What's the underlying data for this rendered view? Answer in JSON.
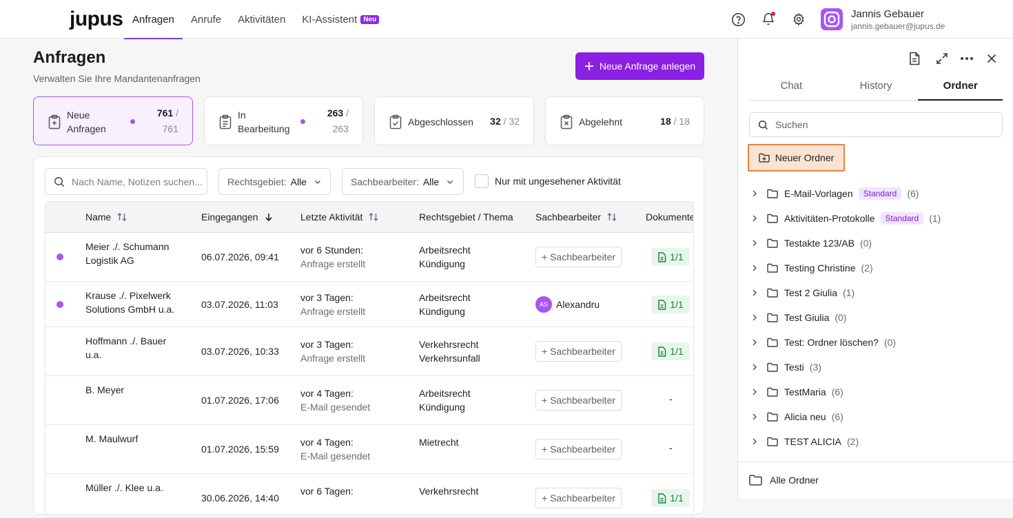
{
  "app": {
    "logo": "jupus",
    "nav": [
      {
        "label": "Anfragen"
      },
      {
        "label": "Anrufe"
      },
      {
        "label": "Aktivitäten"
      },
      {
        "label": "KI-Assistent",
        "badge": "Neu"
      }
    ],
    "icons": [
      "help-icon",
      "bell-icon",
      "gear-icon"
    ],
    "user": {
      "name": "Jannis Gebauer",
      "email": "jannis.gebauer@jupus.de"
    },
    "accent": "#8b1fe3"
  },
  "page": {
    "title": "Anfragen",
    "subtitle": "Verwalten Sie Ihre Mandantenanfragen",
    "new_button": "Neue Anfrage anlegen"
  },
  "stats": [
    {
      "line1": "Neue",
      "line2": "Anfragen",
      "count": "761",
      "total": "/",
      "total2": "761"
    },
    {
      "line1": "In",
      "line2": "Bearbeitung",
      "count": "263",
      "total": "/",
      "total2": "263"
    },
    {
      "label": "Abgeschlossen",
      "count": "32",
      "total": "/ 32"
    },
    {
      "label": "Abgelehnt",
      "count": "18",
      "total": "/ 18"
    }
  ],
  "filters": {
    "search_placeholder": "Nach Name, Notizen suchen...",
    "rechtsgebiet_label": "Rechtsgebiet:",
    "rechtsgebiet_value": "Alle",
    "sachbearbeiter_label": "Sachbearbeiter:",
    "sachbearbeiter_value": "Alle",
    "unseen_label": "Nur mit ungesehener Aktivität"
  },
  "table": {
    "headers": {
      "name": "Name",
      "received": "Eingegangen",
      "last_activity": "Letzte Aktivität",
      "area": "Rechtsgebiet / Thema",
      "assignee": "Sachbearbeiter",
      "documents": "Dokumente"
    },
    "assign_label": "+ Sachbearbeiter",
    "rows": [
      {
        "name1": "Meier ./. Schumann",
        "name2": "Logistik AG",
        "received": "06.07.2026, 09:41",
        "act1": "vor 6 Stunden:",
        "act2": "Anfrage erstellt",
        "area1": "Arbeitsrecht",
        "area2": "Kündigung",
        "docs": "1/1"
      },
      {
        "name1": "Krause ./. Pixelwerk",
        "name2": "Solutions GmbH u.a.",
        "received": "03.07.2026, 11:03",
        "act1": "vor 3 Tagen:",
        "act2": "Anfrage erstellt",
        "area1": "Arbeitsrecht",
        "area2": "Kündigung",
        "assignee_initials": "AS",
        "assignee_name": "Alexandru",
        "docs": "1/1"
      },
      {
        "name1": "Hoffmann ./. Bauer",
        "name2": "u.a.",
        "received": "03.07.2026, 10:33",
        "act1": "vor 3 Tagen:",
        "act2": "Anfrage erstellt",
        "area1": "Verkehrsrecht",
        "area2": "Verkehrsunfall",
        "docs": "1/1"
      },
      {
        "name1": "B. Meyer",
        "name2": "",
        "received": "01.07.2026, 17:06",
        "act1": "vor 4 Tagen:",
        "act2": "E-Mail gesendet",
        "area1": "Arbeitsrecht",
        "area2": "Kündigung",
        "docs": "-"
      },
      {
        "name1": "M. Maulwurf",
        "name2": "",
        "received": "01.07.2026, 15:59",
        "act1": "vor 4 Tagen:",
        "act2": "E-Mail gesendet",
        "area1": "Mietrecht",
        "area2": "",
        "docs": "-"
      },
      {
        "name1": "Müller ./. Klee u.a.",
        "name2": "",
        "received": "30.06.2026, 14:40",
        "act1": "vor 6 Tagen:",
        "act2": "",
        "area1": "Verkehrsrecht",
        "area2": "",
        "docs": "1/1"
      }
    ]
  },
  "sidebar": {
    "icons": [
      "document-icon",
      "expand-icon",
      "more-icon",
      "close-icon"
    ],
    "tabs": [
      {
        "label": "Chat"
      },
      {
        "label": "History"
      },
      {
        "label": "Ordner"
      }
    ],
    "search_placeholder": "Suchen",
    "new_folder": "Neuer Ordner",
    "folders": [
      {
        "name": "E-Mail-Vorlagen",
        "tag": "Standard",
        "count": "(6)"
      },
      {
        "name": "Aktivitäten-Protokolle",
        "tag": "Standard",
        "count": "(1)"
      },
      {
        "name": "Testakte 123/AB",
        "count": "(0)"
      },
      {
        "name": "Testing Christine",
        "count": "(2)"
      },
      {
        "name": "Test 2 Giulia",
        "count": "(1)"
      },
      {
        "name": "Test Giulia",
        "count": "(0)"
      },
      {
        "name": "Test: Ordner löschen?",
        "count": "(0)"
      },
      {
        "name": "Testi",
        "count": "(3)"
      },
      {
        "name": "TestMaria",
        "count": "(6)"
      },
      {
        "name": "Alicia neu",
        "count": "(6)"
      },
      {
        "name": "TEST ALICIA",
        "count": "(2)"
      }
    ],
    "all_folders": "Alle Ordner"
  }
}
